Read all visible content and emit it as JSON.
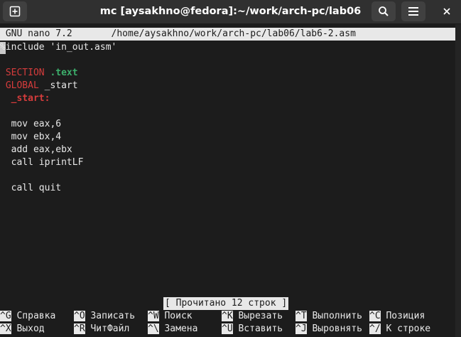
{
  "window": {
    "title": "mc [aysakhno@fedora]:~/work/arch-pc/lab06"
  },
  "nano": {
    "header": " GNU nano 7.2       /home/aysakhno/work/arch-pc/lab06/lab6-2.asm",
    "lines": [
      {
        "parts": [
          {
            "t": "%include 'in_out.asm'",
            "c": ""
          }
        ]
      },
      {
        "parts": []
      },
      {
        "parts": [
          {
            "t": " SECTION",
            "c": "kw"
          },
          {
            "t": " ",
            "c": ""
          },
          {
            "t": ".text",
            "c": "dir"
          }
        ]
      },
      {
        "parts": [
          {
            "t": " GLOBAL",
            "c": "kw"
          },
          {
            "t": " _start",
            "c": ""
          }
        ]
      },
      {
        "parts": [
          {
            "t": "  _start:",
            "c": "lbl"
          }
        ]
      },
      {
        "parts": []
      },
      {
        "parts": [
          {
            "t": "  mov eax,6",
            "c": ""
          }
        ]
      },
      {
        "parts": [
          {
            "t": "  mov ebx,4",
            "c": ""
          }
        ]
      },
      {
        "parts": [
          {
            "t": "  add eax,ebx",
            "c": ""
          }
        ]
      },
      {
        "parts": [
          {
            "t": "  call iprintLF",
            "c": ""
          }
        ]
      },
      {
        "parts": []
      },
      {
        "parts": [
          {
            "t": "  call quit",
            "c": ""
          }
        ]
      }
    ],
    "status": "[ Прочитано 12 строк ]",
    "shortcuts_row1": [
      {
        "key": "^G",
        "label": "Справка"
      },
      {
        "key": "^O",
        "label": "Записать"
      },
      {
        "key": "^W",
        "label": "Поиск"
      },
      {
        "key": "^K",
        "label": "Вырезать"
      },
      {
        "key": "^T",
        "label": "Выполнить"
      },
      {
        "key": "^C",
        "label": "Позиция"
      }
    ],
    "shortcuts_row2": [
      {
        "key": "^X",
        "label": "Выход"
      },
      {
        "key": "^R",
        "label": "ЧитФайл"
      },
      {
        "key": "^\\",
        "label": "Замена"
      },
      {
        "key": "^U",
        "label": "Вставить"
      },
      {
        "key": "^J",
        "label": "Выровнять"
      },
      {
        "key": "^/",
        "label": "К строке"
      }
    ]
  },
  "icons": {
    "new_tab": "new-tab-icon",
    "search": "search-icon",
    "menu": "hamburger-menu-icon",
    "close": "close-icon"
  }
}
